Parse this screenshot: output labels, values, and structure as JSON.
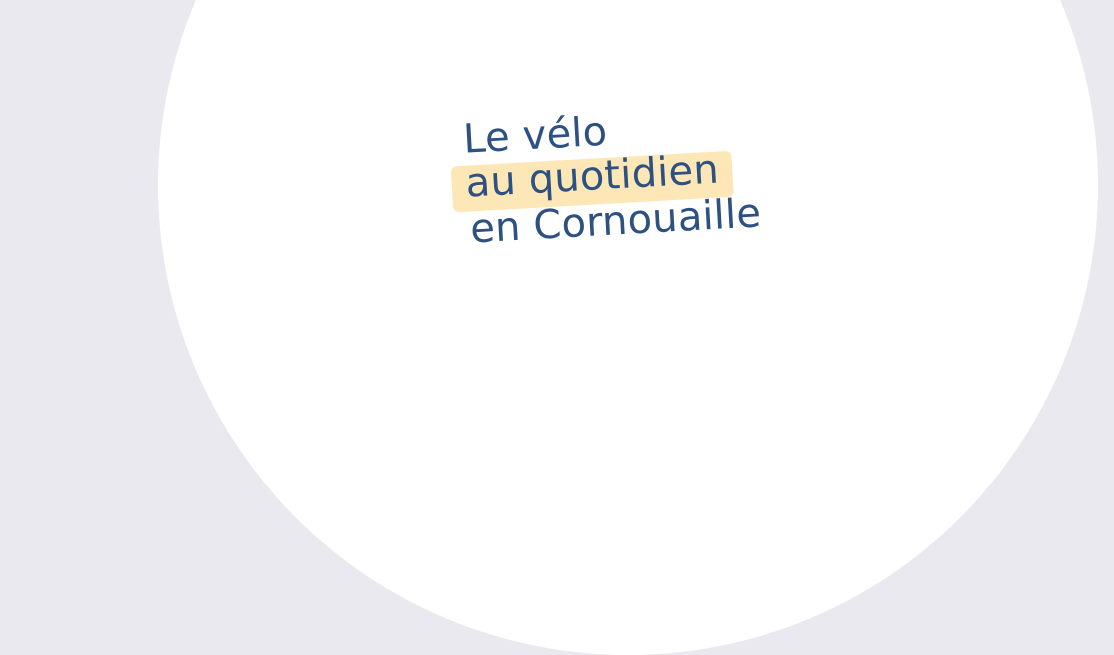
{
  "headline": {
    "line_1": "Le vélo",
    "line_2": "au quotidien",
    "line_3": "en Cornouaille"
  },
  "colors": {
    "background": "#e9e9ef",
    "circle": "#ffffff",
    "text": "#2d5181",
    "highlight": "#fde7b6"
  }
}
